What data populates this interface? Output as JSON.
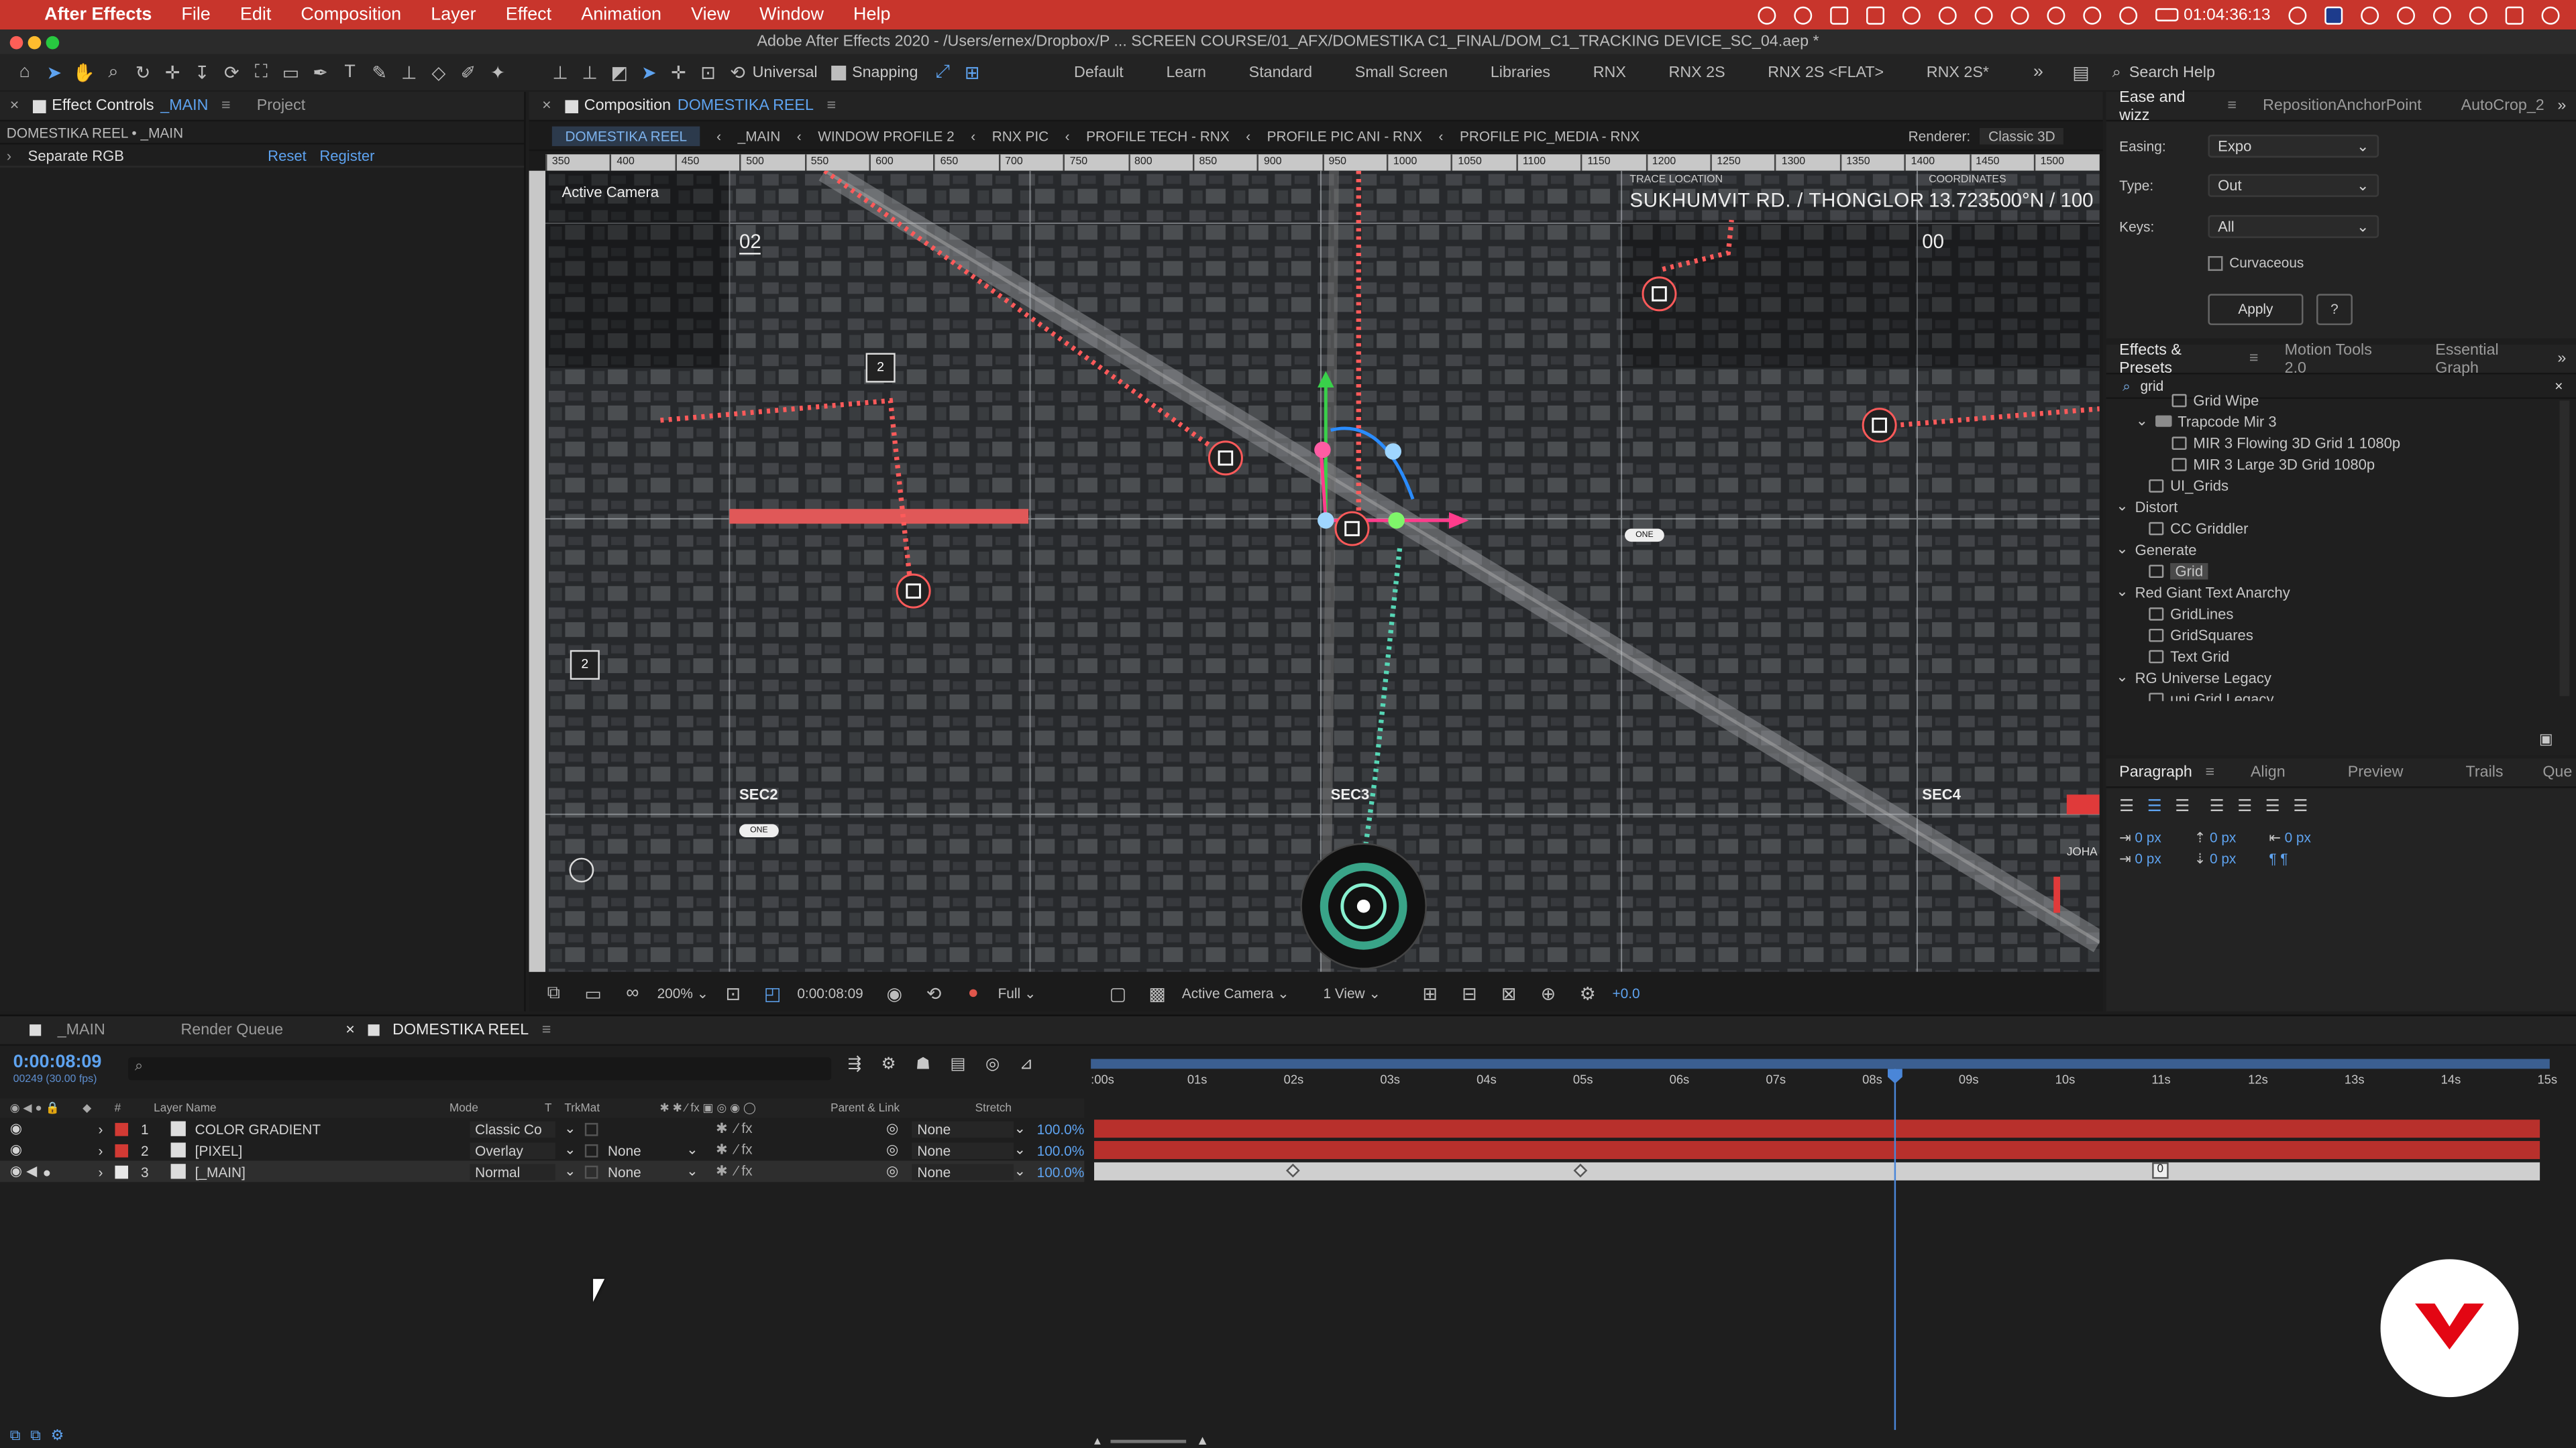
{
  "menubar": {
    "app": "After Effects",
    "items": [
      "File",
      "Edit",
      "Composition",
      "Layer",
      "Effect",
      "Animation",
      "View",
      "Window",
      "Help"
    ],
    "clock": "01:04:36:13"
  },
  "window": {
    "title": "Adobe After Effects 2020 - /Users/ernex/Dropbox/P ...  SCREEN COURSE/01_AFX/DOMESTIKA C1_FINAL/DOM_C1_TRACKING DEVICE_SC_04.aep *"
  },
  "toolbar": {
    "axis": "Universal",
    "snapping": "Snapping",
    "workspaces": [
      "Default",
      "Learn",
      "Standard",
      "Small Screen",
      "Libraries",
      "RNX",
      "RNX 2S",
      "RNX 2S <FLAT>",
      "RNX 2S*"
    ],
    "search_placeholder": "Search Help"
  },
  "effect_controls": {
    "tab": "Effect Controls",
    "tab_target": "_MAIN",
    "tab2": "Project",
    "subtitle": "DOMESTIKA REEL • _MAIN",
    "effect_name": "Separate RGB",
    "reset": "Reset",
    "register": "Register"
  },
  "comp": {
    "tab_label": "Composition",
    "comp_name": "DOMESTIKA REEL",
    "crumbs": [
      "DOMESTIKA REEL",
      "_MAIN",
      "WINDOW PROFILE 2",
      "RNX PIC",
      "PROFILE TECH - RNX",
      "PROFILE PIC ANI - RNX",
      "PROFILE PIC_MEDIA - RNX"
    ],
    "renderer_label": "Renderer:",
    "renderer": "Classic 3D",
    "camera_label": "Active Camera",
    "ruler": [
      "350",
      "400",
      "450",
      "500",
      "550",
      "600",
      "650",
      "700",
      "750",
      "800",
      "850",
      "900",
      "950",
      "1000",
      "1050",
      "1100",
      "1150",
      "1200",
      "1250",
      "1300",
      "1350",
      "1400",
      "1450",
      "1500"
    ],
    "overlay": {
      "trace_label": "TRACE LOCATION",
      "trace_value": "SUKHUMVIT RD. / THONGLOR",
      "coord_label": "COORDINATES",
      "coord_value": "13.723500°N / 100",
      "num_left": "02",
      "num_right": "00",
      "box1": "2",
      "box2": "2",
      "sec2": "SEC2",
      "sec3": "SEC3",
      "sec4": "SEC4",
      "pill1": "ONE",
      "pill2": "ONE",
      "side_text": "JOHA"
    },
    "footer": {
      "zoom": "200%",
      "time": "0:00:08:09",
      "resolution": "Full",
      "camera": "Active Camera",
      "views": "1 View",
      "exposure": "+0.0"
    }
  },
  "ease": {
    "tabs": [
      "Ease and wizz",
      "RepositionAnchorPoint",
      "AutoCrop_2"
    ],
    "easing_label": "Easing:",
    "easing": "Expo",
    "type_label": "Type:",
    "type": "Out",
    "keys_label": "Keys:",
    "keys": "All",
    "curvaceous": "Curvaceous",
    "apply": "Apply",
    "help": "?"
  },
  "effects_presets": {
    "tabs": [
      "Effects & Presets",
      "Motion Tools 2.0",
      "Essential Graph"
    ],
    "search": "grid",
    "items": [
      {
        "label": "Grid Wipe",
        "level": 2,
        "kind": "fx"
      },
      {
        "label": "Trapcode Mir 3",
        "level": 1,
        "kind": "folder"
      },
      {
        "label": "MIR 3 Flowing 3D Grid 1 1080p",
        "level": 2,
        "kind": "fx"
      },
      {
        "label": "MIR 3 Large 3D Grid 1080p",
        "level": 2,
        "kind": "fx"
      },
      {
        "label": "UI_Grids",
        "level": 1,
        "kind": "fx"
      },
      {
        "label": "Distort",
        "level": 0,
        "kind": "cat"
      },
      {
        "label": "CC Griddler",
        "level": 1,
        "kind": "fx"
      },
      {
        "label": "Generate",
        "level": 0,
        "kind": "cat"
      },
      {
        "label": "Grid",
        "level": 1,
        "kind": "fx",
        "selected": true
      },
      {
        "label": "Red Giant Text Anarchy",
        "level": 0,
        "kind": "cat"
      },
      {
        "label": "GridLines",
        "level": 1,
        "kind": "fx"
      },
      {
        "label": "GridSquares",
        "level": 1,
        "kind": "fx"
      },
      {
        "label": "Text Grid",
        "level": 1,
        "kind": "fx"
      },
      {
        "label": "RG Universe Legacy",
        "level": 0,
        "kind": "cat"
      },
      {
        "label": "uni.Grid Legacy",
        "level": 1,
        "kind": "fx"
      }
    ]
  },
  "paragraph": {
    "tabs": [
      "Paragraph",
      "Align",
      "Preview",
      "Trails",
      "Que"
    ],
    "indent_values": [
      "0 px",
      "0 px",
      "0 px",
      "0 px",
      "0 px"
    ]
  },
  "timeline": {
    "tabs": [
      "_MAIN",
      "Render Queue",
      "DOMESTIKA REEL"
    ],
    "timecode": "0:00:08:09",
    "frames": "00249 (30.00 fps)",
    "cols": {
      "num": "#",
      "name": "Layer Name",
      "mode": "Mode",
      "t": "T",
      "trkmat": "TrkMat",
      "parent": "Parent & Link",
      "stretch": "Stretch"
    },
    "ruler": [
      ":00s",
      "01s",
      "02s",
      "03s",
      "04s",
      "05s",
      "06s",
      "07s",
      "08s",
      "09s",
      "10s",
      "11s",
      "12s",
      "13s",
      "14s",
      "15s"
    ],
    "layers": [
      {
        "num": "1",
        "name": "COLOR GRADIENT",
        "mode": "Classic Co",
        "trkmat": "",
        "parent": "None",
        "stretch": "100.0%",
        "color": "#d23a34"
      },
      {
        "num": "2",
        "name": "[PIXEL]",
        "mode": "Overlay",
        "trkmat": "None",
        "parent": "None",
        "stretch": "100.0%",
        "color": "#d23a34"
      },
      {
        "num": "3",
        "name": "[_MAIN]",
        "mode": "Normal",
        "trkmat": "None",
        "parent": "None",
        "stretch": "100.0%",
        "color": "#e8e8e8"
      }
    ],
    "marker": "0"
  },
  "colors": {
    "accent": "#5ea3f0",
    "brand": "#e30613",
    "layer_bar": "#b8302c",
    "menubar": "#c8352c"
  }
}
